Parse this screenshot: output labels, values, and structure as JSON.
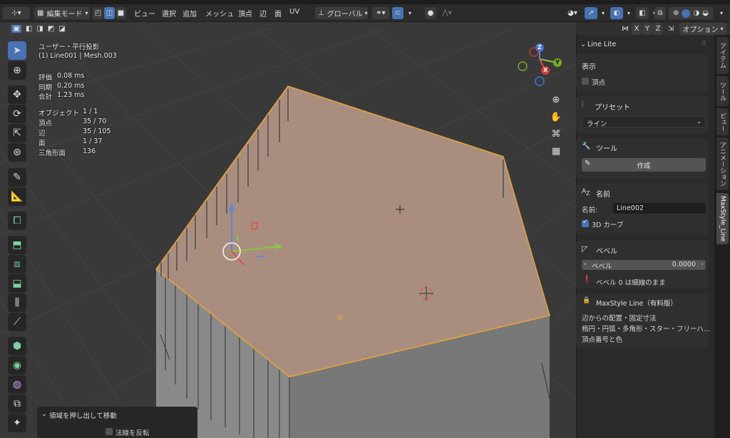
{
  "header": {
    "mode_label": "編集モード",
    "menus": [
      "ビュー",
      "選択",
      "追加",
      "メッシュ",
      "頂点",
      "辺",
      "面",
      "UV"
    ],
    "orientation_label": "グローバル",
    "axes": [
      "X",
      "Y",
      "Z"
    ],
    "options_label": "オプション"
  },
  "overlay": {
    "view_name": "ユーザー・平行投影",
    "object_name": "(1) Line001 | Mesh.003",
    "timing": [
      {
        "label": "評価",
        "value": "0.08 ms"
      },
      {
        "label": "同期",
        "value": "0.20 ms"
      },
      {
        "label": "合計",
        "value": "1.23 ms"
      }
    ],
    "stats": [
      {
        "label": "オブジェクト",
        "value": "1 / 1"
      },
      {
        "label": "頂点",
        "value": "35 / 70"
      },
      {
        "label": "辺",
        "value": "35 / 105"
      },
      {
        "label": "面",
        "value": "1 / 37"
      },
      {
        "label": "三角形面",
        "value": "136"
      }
    ]
  },
  "gizmo": {
    "x": "X",
    "y": "Y",
    "z": "Z"
  },
  "operator_panel": {
    "title": "領域を押し出して移動",
    "flip_normals_label": "法線を反転"
  },
  "sidebar": {
    "header_title": "Line Lite",
    "display": {
      "title": "表示",
      "vertex_label": "頂点",
      "vertex_checked": false
    },
    "preset": {
      "title": "プリセット",
      "value": "ライン"
    },
    "tool": {
      "title": "ツール",
      "create_label": "作成"
    },
    "name": {
      "title": "名前",
      "name_label": "名前:",
      "name_value": "Line002",
      "curve_label": "3D カーブ",
      "curve_checked": true
    },
    "bevel": {
      "title": "ベベル",
      "field_label": "ベベル",
      "field_value": "0.0000",
      "note": "ベベル 0 は細線のまま"
    },
    "maxstyle": {
      "title": "MaxStyle Line（有料版）",
      "lines": [
        "辺からの配置・固定寸法",
        "楕円・円弧・多角形・スター・フリーハ...",
        "頂点番号と色"
      ]
    }
  },
  "tabs": [
    "アイテム",
    "ツール",
    "ビュー",
    "アニメーション",
    "MaxStyle_Line"
  ],
  "colors": {
    "accent": "#4772b3",
    "face_selected": "#a98e80",
    "edge_selected": "#e8a33a"
  }
}
